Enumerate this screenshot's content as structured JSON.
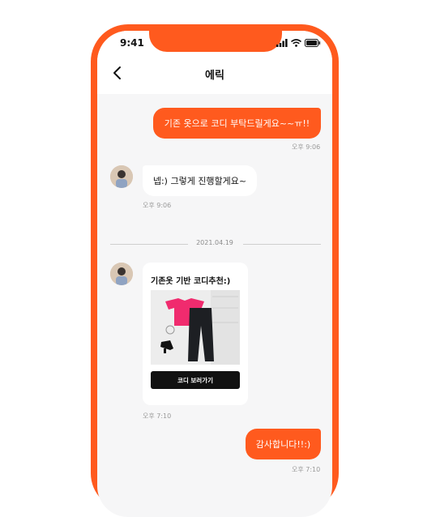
{
  "status_bar": {
    "time": "9:41"
  },
  "header": {
    "title": "에릭"
  },
  "messages": [
    {
      "text": "기존 옷으로 코디 부탁드릴게요~~ㅠ!!",
      "time": "오후 9:06"
    },
    {
      "text": "넵:) 그렇게 진행할게요~",
      "time": "오후 9:06"
    },
    {
      "card_title": "기존옷 기반 코디추천:)",
      "button_label": "코디 보러가기",
      "time": "오후 7:10"
    },
    {
      "text": "감사합니다!!:)",
      "time": "오후 7:10"
    }
  ],
  "date_divider": "2021.04.19",
  "colors": {
    "accent": "#ff5a1e",
    "background": "#f6f6f7"
  }
}
